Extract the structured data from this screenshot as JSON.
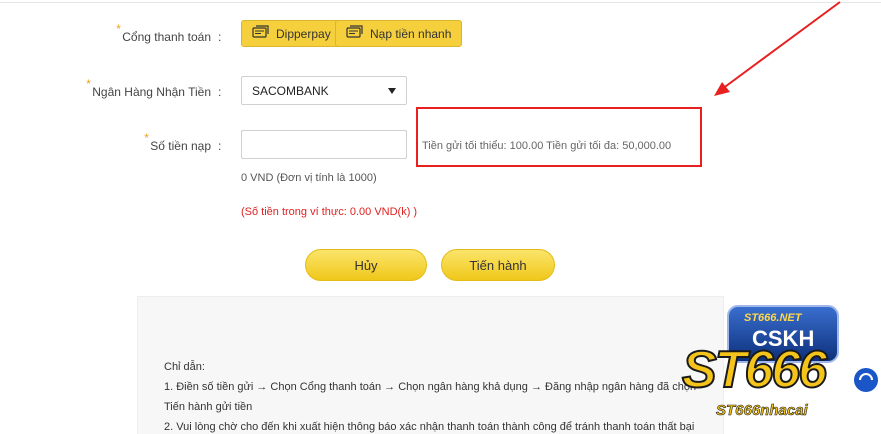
{
  "form": {
    "gateway_label": "Cổng thanh toán",
    "gateway_buttons": [
      "Dipperpay",
      "Nạp tiền nhanh"
    ],
    "bank_label": "Ngân Hàng Nhận Tiền",
    "bank_selected": "SACOMBANK",
    "amount_label": "Số tiền nạp",
    "colon": ":",
    "amount_value": "",
    "limits": "Tiền gửi tối thiểu: 100.00 Tiền gửi tối đa: 50,000.00",
    "amount_vnd": "0 VND (Đơn vị tính là 1000)",
    "wallet_balance": "(Số tiền trong ví thực: 0.00 VND(k) )",
    "cancel_label": "Hủy",
    "proceed_label": "Tiến hành"
  },
  "guide": {
    "title": "Chỉ dẫn:",
    "lines": [
      "1. Điền số tiền gửi → Chọn Cổng thanh toán → Chọn ngân hàng khả dụng → Đăng nhập ngân hàng đã chọn",
      "Tiến hành gửi tiền",
      "2. Vui lòng chờ cho đến khi xuất hiện thông báo xác nhận thanh toán thành công để tránh thanh toán thất bại"
    ]
  },
  "watermark": {
    "badge_top": "ST666.NET",
    "badge_bottom": "CSKH",
    "brand": "ST666",
    "tagline": "ST666nhacai"
  },
  "colors": {
    "accent_yellow": "#f5d03c",
    "highlight_red": "#e82020",
    "error_red": "#e02020"
  },
  "icons": {
    "gateway_icon": "card-stack-icon",
    "select_icon": "caret-down-icon"
  }
}
